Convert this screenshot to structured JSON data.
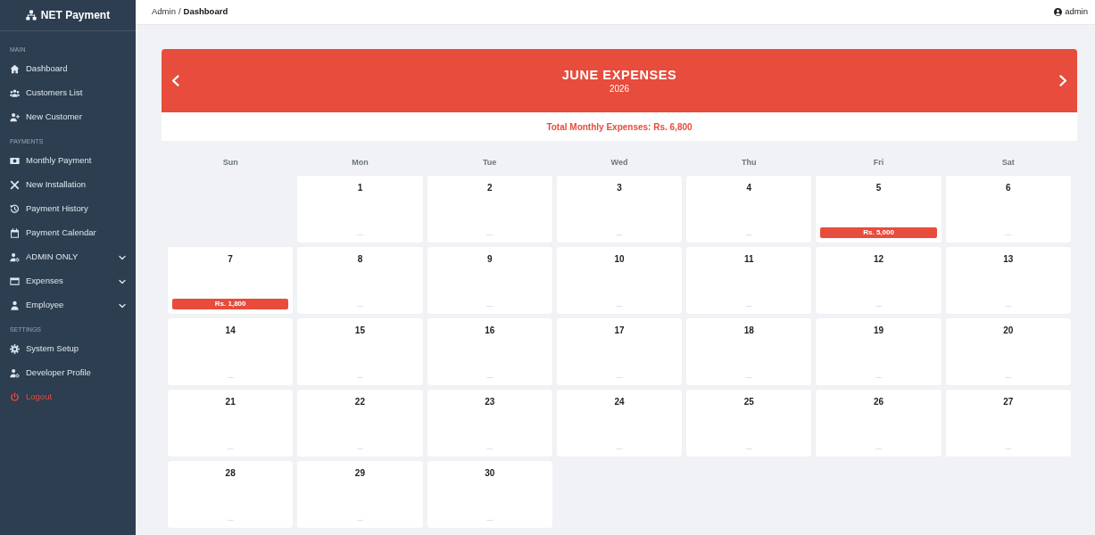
{
  "top_bar": {
    "breadcrumb": [
      {
        "label": "Admin",
        "current": false
      },
      {
        "label": "Dashboard",
        "current": true
      }
    ],
    "separator": "/",
    "user": "admin"
  },
  "sidebar": {
    "brand": "NET Payment",
    "sections": [
      {
        "heading": "MAIN",
        "items": [
          {
            "label": "Dashboard",
            "kind": "link"
          },
          {
            "label": "Customers List",
            "kind": "link"
          },
          {
            "label": "New Customer",
            "kind": "link"
          }
        ]
      },
      {
        "heading": "PAYMENTS",
        "items": [
          {
            "label": "Monthly Payment",
            "kind": "link"
          },
          {
            "label": "New Installation",
            "kind": "link"
          },
          {
            "label": "Payment History",
            "kind": "link"
          },
          {
            "label": "Payment Calendar",
            "kind": "link"
          },
          {
            "label": "ADMIN ONLY",
            "kind": "dropdown"
          },
          {
            "label": "Expenses",
            "kind": "dropdown"
          },
          {
            "label": "Employee",
            "kind": "dropdown"
          }
        ]
      },
      {
        "heading": "SETTINGS",
        "items": [
          {
            "label": "System Setup",
            "kind": "link"
          },
          {
            "label": "Developer Profile",
            "kind": "link"
          },
          {
            "label": "Logout",
            "kind": "danger"
          }
        ]
      }
    ]
  },
  "calendar": {
    "title": "JUNE EXPENSES",
    "year": "2026",
    "total": "Total Monthly Expenses: Rs. 6,800",
    "weekdays": [
      "Sun",
      "Mon",
      "Tue",
      "Wed",
      "Thu",
      "Fri",
      "Sat"
    ],
    "days": [
      {
        "kind": "blank"
      },
      {
        "day": "1",
        "kind": "empty",
        "amount": "—"
      },
      {
        "day": "2",
        "kind": "empty",
        "amount": "—"
      },
      {
        "day": "3",
        "kind": "empty",
        "amount": "—"
      },
      {
        "day": "4",
        "kind": "empty",
        "amount": "—"
      },
      {
        "day": "5",
        "kind": "expense",
        "amount": "Rs. 5,000"
      },
      {
        "day": "6",
        "kind": "empty",
        "amount": "—"
      },
      {
        "day": "7",
        "kind": "expense",
        "amount": "Rs. 1,800"
      },
      {
        "day": "8",
        "kind": "empty",
        "amount": "—"
      },
      {
        "day": "9",
        "kind": "empty",
        "amount": "—"
      },
      {
        "day": "10",
        "kind": "empty",
        "amount": "—"
      },
      {
        "day": "11",
        "kind": "empty",
        "amount": "—"
      },
      {
        "day": "12",
        "kind": "empty",
        "amount": "—"
      },
      {
        "day": "13",
        "kind": "empty",
        "amount": "—"
      },
      {
        "day": "14",
        "kind": "empty",
        "amount": "—"
      },
      {
        "day": "15",
        "kind": "empty",
        "amount": "—"
      },
      {
        "day": "16",
        "kind": "empty",
        "amount": "—"
      },
      {
        "day": "17",
        "kind": "empty",
        "amount": "—"
      },
      {
        "day": "18",
        "kind": "empty",
        "amount": "—"
      },
      {
        "day": "19",
        "kind": "empty",
        "amount": "—"
      },
      {
        "day": "20",
        "kind": "empty",
        "amount": "—"
      },
      {
        "day": "21",
        "kind": "empty",
        "amount": "—"
      },
      {
        "day": "22",
        "kind": "empty",
        "amount": "—"
      },
      {
        "day": "23",
        "kind": "empty",
        "amount": "—"
      },
      {
        "day": "24",
        "kind": "empty",
        "amount": "—"
      },
      {
        "day": "25",
        "kind": "empty",
        "amount": "—"
      },
      {
        "day": "26",
        "kind": "empty",
        "amount": "—"
      },
      {
        "day": "27",
        "kind": "empty",
        "amount": "—"
      },
      {
        "day": "28",
        "kind": "empty",
        "amount": "—"
      },
      {
        "day": "29",
        "kind": "empty",
        "amount": "—"
      },
      {
        "day": "30",
        "kind": "empty",
        "amount": "—"
      }
    ]
  }
}
